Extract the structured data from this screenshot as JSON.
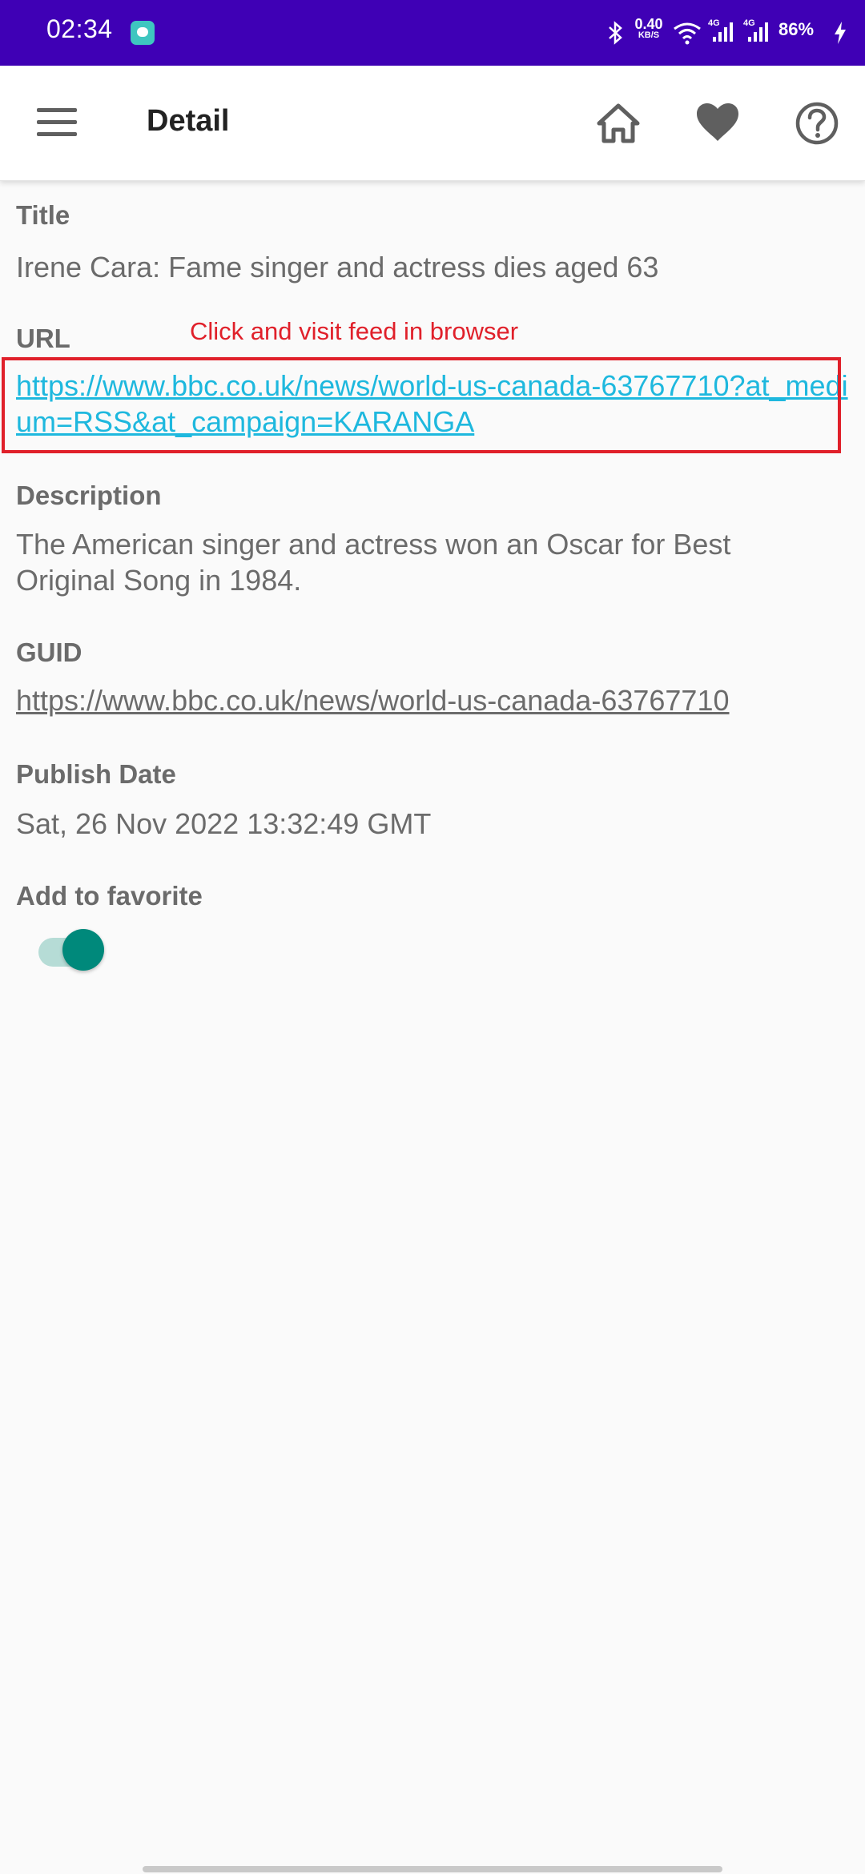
{
  "status_bar": {
    "time": "02:34",
    "net_speed": "0.40",
    "net_unit": "KB/S",
    "battery": "86%",
    "bg_color": "#3f00b5"
  },
  "app_bar": {
    "title": "Detail",
    "icons": [
      "menu-icon",
      "home-icon",
      "heart-icon",
      "help-icon"
    ]
  },
  "detail": {
    "title_label": "Title",
    "title_value": "Irene Cara: Fame singer and actress dies aged 63",
    "url_label": "URL",
    "url_value": "https://www.bbc.co.uk/news/world-us-canada-63767710?at_medium=RSS&at_campaign=KARANGA",
    "description_label": "Description",
    "description_value": "The American singer and actress won an Oscar for Best Original Song in 1984.",
    "guid_label": "GUID",
    "guid_value": "https://www.bbc.co.uk/news/world-us-canada-63767710",
    "publish_label": "Publish Date",
    "publish_value": "Sat, 26 Nov 2022 13:32:49 GMT",
    "favorite_label": "Add to favorite",
    "favorite_on": true
  },
  "annotation": {
    "text": "Click and visit feed in browser",
    "color": "#e0202a"
  },
  "colors": {
    "link": "#1eb8de",
    "accent": "#00897b"
  }
}
